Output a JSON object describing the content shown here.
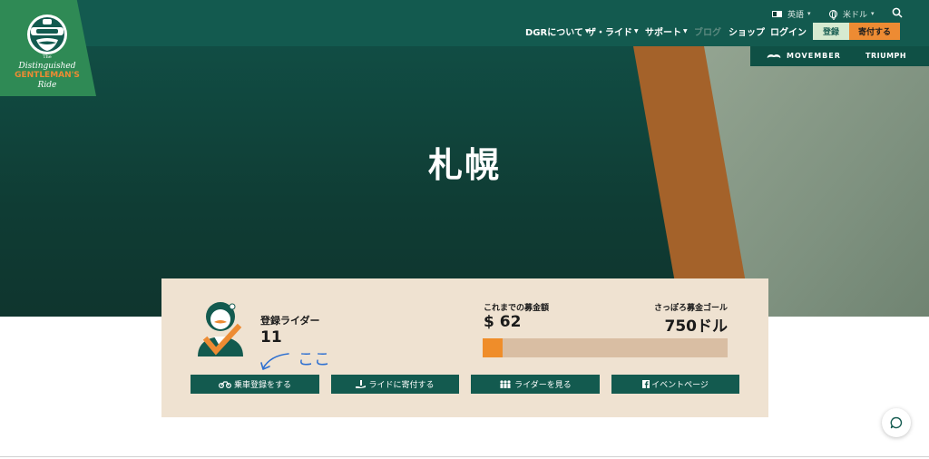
{
  "header": {
    "utility": {
      "language": "英語",
      "currency": "米ドル"
    },
    "nav": [
      {
        "label": "DGRについて",
        "has_menu": true
      },
      {
        "label": "ザ・ライド",
        "has_menu": true
      },
      {
        "label": "サポート",
        "has_menu": true
      },
      {
        "label": "ブログ",
        "has_menu": false
      },
      {
        "label": "ショップ",
        "has_menu": false
      },
      {
        "label": "ログイン",
        "has_menu": false
      }
    ],
    "register_label": "登録",
    "donate_label": "寄付する",
    "sponsors": [
      "MOVEMBER",
      "TRIUMPH"
    ]
  },
  "logo": {
    "text_lines": [
      "The",
      "Distinguished",
      "GENTLEMAN'S",
      "Ride"
    ]
  },
  "hero": {
    "title": "札幌"
  },
  "card": {
    "riders_label": "登録ライダー",
    "riders_count": "11",
    "raised_label": "これまでの募金額",
    "raised_value": "$ 62",
    "goal_label": "さっぽろ募金ゴール",
    "goal_value": "750ドル",
    "progress_fraction": 0.083,
    "buttons": [
      {
        "label": "乗車登録をする",
        "icon": "motorcycle-icon"
      },
      {
        "label": "ライドに寄付する",
        "icon": "hand-donate-icon"
      },
      {
        "label": "ライダーを見る",
        "icon": "people-icon"
      },
      {
        "label": "イベントページ",
        "icon": "facebook-icon"
      }
    ],
    "annotation_text": "ここ"
  },
  "colors": {
    "header_green": "#135a4f",
    "accent_orange": "#ed8b33",
    "card_beige": "#efe2d1",
    "logo_green": "#2f8a55"
  }
}
